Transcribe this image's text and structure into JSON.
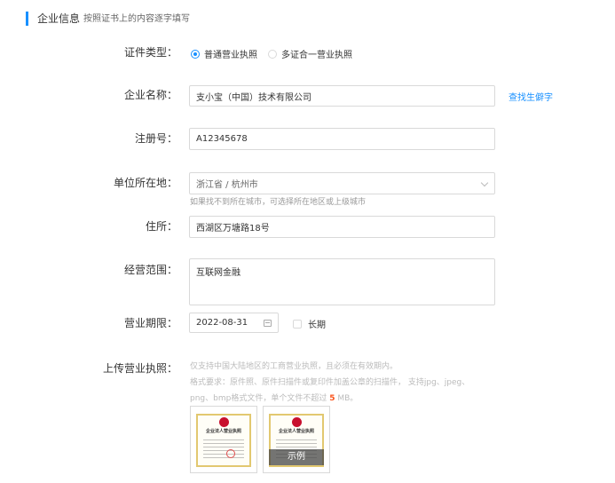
{
  "section": {
    "title": "企业信息",
    "hint": "按照证书上的内容逐字填写"
  },
  "form": {
    "cert_type": {
      "label": "证件类型：",
      "options": [
        {
          "label": "普通营业执照",
          "checked": true
        },
        {
          "label": "多证合一营业执照",
          "checked": false
        }
      ]
    },
    "company_name": {
      "label": "企业名称：",
      "value": "支小宝（中国）技术有限公司",
      "link": "查找生僻字"
    },
    "reg_no": {
      "label": "注册号：",
      "value": "A12345678"
    },
    "location": {
      "label": "单位所在地：",
      "value": "浙江省 / 杭州市",
      "hint": "如果找不到所在城市，可选择所在地区或上级城市"
    },
    "address": {
      "label": "住所：",
      "value": "西湖区万塘路18号"
    },
    "scope": {
      "label": "经营范围：",
      "value": "互联网金融"
    },
    "term": {
      "label": "营业期限：",
      "date": "2022-08-31",
      "long_term": "长期",
      "long_term_checked": false
    },
    "upload": {
      "label": "上传营业执照：",
      "hint_line1": "仅支持中国大陆地区的工商营业执照，且必须在有效期内。",
      "hint_line2": "格式要求：原件照、原件扫描件或复印件加盖公章的扫描件， 支持jpg、jpeg、",
      "hint_line3_prefix": "png、bmp格式文件，单个文件不超过",
      "hint_line3_num": "5",
      "hint_line3_suffix": "MB。",
      "thumb1_title": "企业法人营业执照",
      "thumb2_title": "企业法人营业执照",
      "example": "示例"
    }
  },
  "colors": {
    "accent": "#1890ff",
    "highlight": "#fa541c",
    "border": "#d9d9d9"
  }
}
